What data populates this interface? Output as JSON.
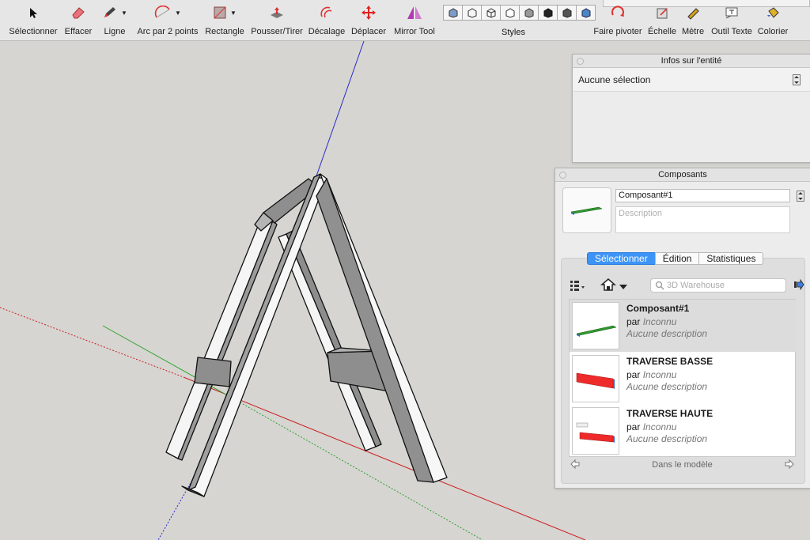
{
  "toolbar": {
    "tools": [
      {
        "label": "Sélectionner",
        "icon": "select-arrow-icon"
      },
      {
        "label": "Effacer",
        "icon": "eraser-icon"
      },
      {
        "label": "Ligne",
        "icon": "pencil-icon"
      },
      {
        "label": "Arc par 2 points",
        "icon": "arc-icon"
      },
      {
        "label": "Rectangle",
        "icon": "rectangle-icon"
      },
      {
        "label": "Pousser/Tirer",
        "icon": "push-pull-icon"
      },
      {
        "label": "Décalage",
        "icon": "offset-icon"
      },
      {
        "label": "Déplacer",
        "icon": "move-icon"
      },
      {
        "label": "Mirror Tool",
        "icon": "mirror-icon"
      },
      {
        "label": "Faire pivoter",
        "icon": "rotate-icon"
      },
      {
        "label": "Échelle",
        "icon": "scale-icon"
      },
      {
        "label": "Mètre",
        "icon": "tape-measure-icon"
      },
      {
        "label": "Outil Texte",
        "icon": "text-tool-icon"
      },
      {
        "label": "Colorier",
        "icon": "paint-bucket-icon"
      }
    ],
    "styles_label": "Styles"
  },
  "entity_panel": {
    "title": "Infos sur l'entité",
    "selection": "Aucune sélection"
  },
  "components_panel": {
    "title": "Composants",
    "name_value": "Composant#1",
    "description_placeholder": "Description",
    "tabs": [
      "Sélectionner",
      "Édition",
      "Statistiques"
    ],
    "search_placeholder": "3D Warehouse",
    "items": [
      {
        "name": "Composant#1",
        "by": "par",
        "author": "Inconnu",
        "desc": "Aucune description"
      },
      {
        "name": "TRAVERSE BASSE",
        "by": "par",
        "author": "Inconnu",
        "desc": "Aucune description"
      },
      {
        "name": "TRAVERSE HAUTE",
        "by": "par",
        "author": "Inconnu",
        "desc": "Aucune description"
      }
    ],
    "footer": "Dans le modèle"
  },
  "colors": {
    "selected_tab": "#3d94f6",
    "axis_red": "#cc1f1f",
    "axis_green": "#2aa22a",
    "axis_blue": "#2b2bcc"
  }
}
